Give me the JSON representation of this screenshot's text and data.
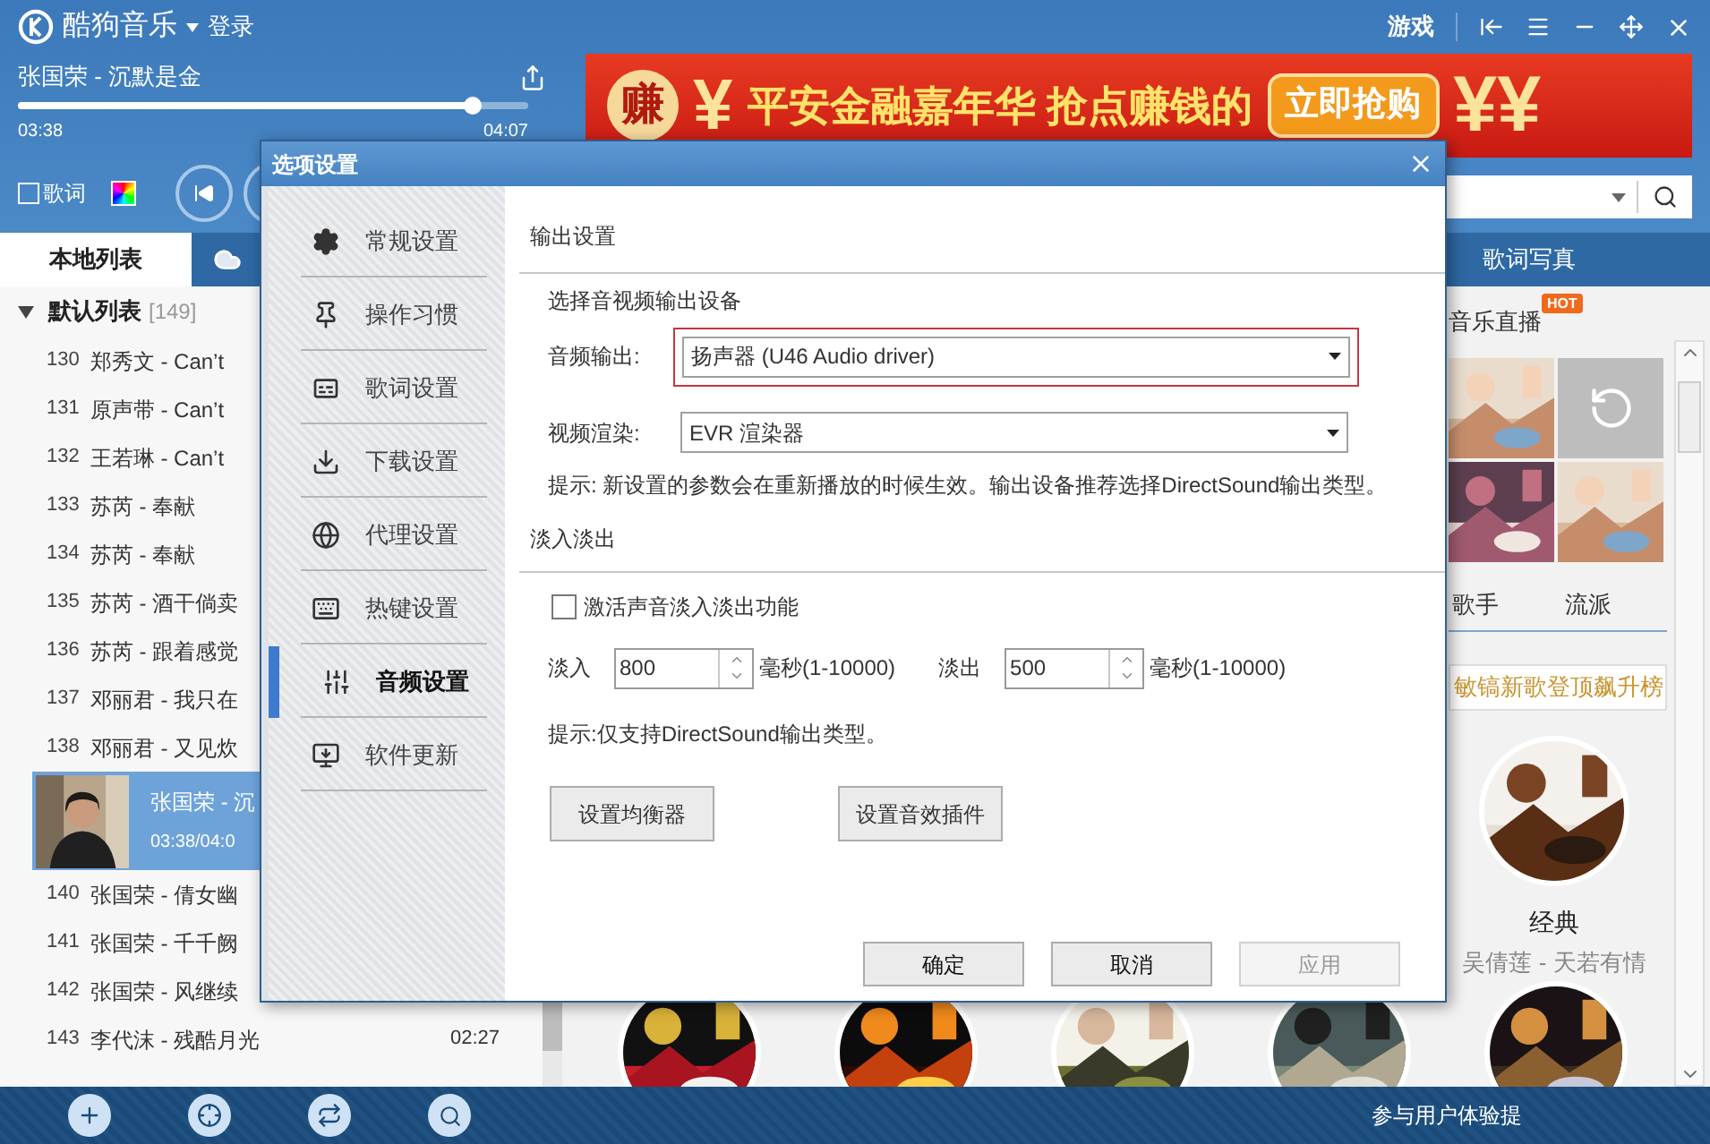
{
  "app": {
    "title": "酷狗音乐",
    "login": "登录",
    "games": "游戏"
  },
  "player": {
    "song": "张国荣 - 沉默是金",
    "elapsed": "03:38",
    "total": "04:07",
    "level": 0.89,
    "lyrics": {
      "label": "歌词",
      "checked": false
    }
  },
  "ad": {
    "badge": "赚",
    "symbol_left": "¥",
    "text": "平安金融嘉年华 抢点赚钱的",
    "button": "立即抢购",
    "symbol_right": "¥¥"
  },
  "left_panel": {
    "tabs": [
      {
        "kind": "text",
        "label": "本地列表",
        "selected": true
      },
      {
        "kind": "cloud",
        "selected": false
      }
    ],
    "playlist": {
      "name": "默认列表",
      "count": "[149]",
      "expanded": true
    },
    "rows": [
      {
        "num": "130",
        "title": "郑秀文 - Can’t",
        "selected": false
      },
      {
        "num": "131",
        "title": "原声带 - Can’t",
        "selected": false
      },
      {
        "num": "132",
        "title": "王若琳 - Can’t",
        "selected": false
      },
      {
        "num": "133",
        "title": "苏芮 - 奉献",
        "selected": false
      },
      {
        "num": "134",
        "title": "苏芮 - 奉献",
        "selected": false
      },
      {
        "num": "135",
        "title": "苏芮 - 酒干倘卖",
        "selected": false
      },
      {
        "num": "136",
        "title": "苏芮 - 跟着感觉",
        "selected": false
      },
      {
        "num": "137",
        "title": "邓丽君 - 我只在",
        "selected": false
      },
      {
        "num": "138",
        "title": "邓丽君 - 又见炊",
        "selected": false
      },
      {
        "title": "张国荣 - 沉",
        "progress": "03:38/04:0",
        "selected": true
      },
      {
        "num": "140",
        "title": "张国荣 - 倩女幽",
        "selected": false
      },
      {
        "num": "141",
        "title": "张国荣 - 千千阙",
        "selected": false
      },
      {
        "num": "142",
        "title": "张国荣 - 风继续",
        "selected": false
      },
      {
        "num": "143",
        "title": "李代沫 - 残酷月光",
        "time": "02:27",
        "selected": false
      }
    ]
  },
  "right_panel": {
    "tab": "歌词写真",
    "live": {
      "label": "音乐直播",
      "badge": "HOT"
    },
    "photos": [
      {
        "kind": "picture"
      },
      {
        "kind": "refresh"
      },
      {
        "kind": "picture"
      },
      {
        "kind": "picture"
      }
    ],
    "categories": [
      "歌手",
      "流派"
    ],
    "promo": "敏镐新歌登顶飙升榜",
    "featured": {
      "title": "经典",
      "subtitle": "吴倩莲 - 天若有情"
    }
  },
  "status": "参与用户体验提",
  "dialog": {
    "title": "选项设置",
    "nav": [
      {
        "kind": "gear",
        "label": "常规设置",
        "selected": false
      },
      {
        "kind": "pin",
        "label": "操作习惯",
        "selected": false
      },
      {
        "kind": "lyrics",
        "label": "歌词设置",
        "selected": false
      },
      {
        "kind": "download",
        "label": "下载设置",
        "selected": false
      },
      {
        "kind": "globe",
        "label": "代理设置",
        "selected": false
      },
      {
        "kind": "keyboard",
        "label": "热键设置",
        "selected": false
      },
      {
        "kind": "sliders",
        "label": "音频设置",
        "selected": true
      },
      {
        "kind": "update",
        "label": "软件更新",
        "selected": false
      }
    ],
    "output": {
      "title": "输出设置",
      "subtitle": "选择音视频输出设备",
      "audio": {
        "label": "音频输出:",
        "value": "扬声器 (U46 Audio driver)",
        "highlighted": true
      },
      "video": {
        "label": "视频渲染:",
        "value": "EVR 渲染器"
      },
      "hint": "提示: 新设置的参数会在重新播放的时候生效。输出设备推荐选择DirectSound输出类型。"
    },
    "fade": {
      "title": "淡入淡出",
      "enable": {
        "label": "激活声音淡入淡出功能",
        "checked": false
      },
      "fade_in": {
        "label": "淡入",
        "value": "800",
        "unit": "毫秒(1-10000)"
      },
      "fade_out": {
        "label": "淡出",
        "value": "500",
        "unit": "毫秒(1-10000)"
      },
      "hint": "提示:仅支持DirectSound输出类型。",
      "buttons": [
        "设置均衡器",
        "设置音效插件"
      ]
    },
    "footer": [
      {
        "label": "确定",
        "disabled": false
      },
      {
        "label": "取消",
        "disabled": false
      },
      {
        "label": "应用",
        "disabled": true
      }
    ]
  }
}
